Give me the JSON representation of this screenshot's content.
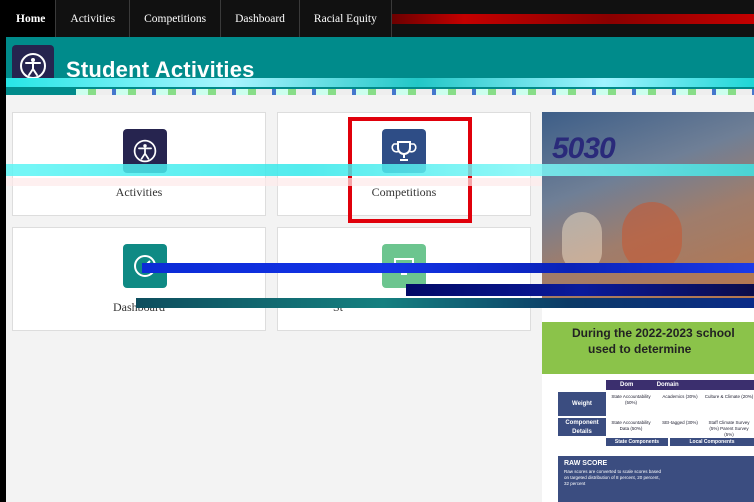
{
  "nav": {
    "items": [
      {
        "label": "Home",
        "active": true
      },
      {
        "label": "Activities"
      },
      {
        "label": "Competitions"
      },
      {
        "label": "Dashboard"
      },
      {
        "label": "Racial Equity"
      }
    ]
  },
  "header": {
    "title": "Student Activities",
    "icon": "accessibility-icon",
    "color": "#008b8b"
  },
  "tiles": [
    {
      "label": "Activities",
      "icon": "accessibility-icon",
      "icon_color": "#26244f"
    },
    {
      "label": "Competitions",
      "icon": "trophy-icon",
      "icon_color": "#2e4d86",
      "highlighted": true
    },
    {
      "label": "Dashboard",
      "icon": "dashboard-gauge-icon",
      "icon_color": "#0f8a84"
    },
    {
      "label": "St",
      "icon": "monitor-icon",
      "icon_color": "#6cc58f"
    }
  ],
  "panel": {
    "photo_title": "5030",
    "band_line1": "During the 2022-2023 school",
    "band_line2": "used to determine",
    "table": {
      "header_cells": [
        "Dom",
        "Domain"
      ],
      "weight_label": "Weight",
      "component_label": "Component Details",
      "columns": [
        {
          "title": "State Accountability (50%)",
          "detail": "State Accountability Data (50%)"
        },
        {
          "title": "Academics (30%)",
          "detail": "SEI-tagged (30%)"
        },
        {
          "title": "Culture & Climate (20%)",
          "detail": "Staff Climate Survey (5%) Parent Survey (5%)"
        }
      ],
      "footer_left": "State Components",
      "footer_right": "Local Components"
    },
    "raw_score": {
      "title": "RAW SCORE",
      "description": "Raw scores are converted to scale scores based on targeted distribution of 8 percent, 20 percent, 32 percent"
    }
  }
}
